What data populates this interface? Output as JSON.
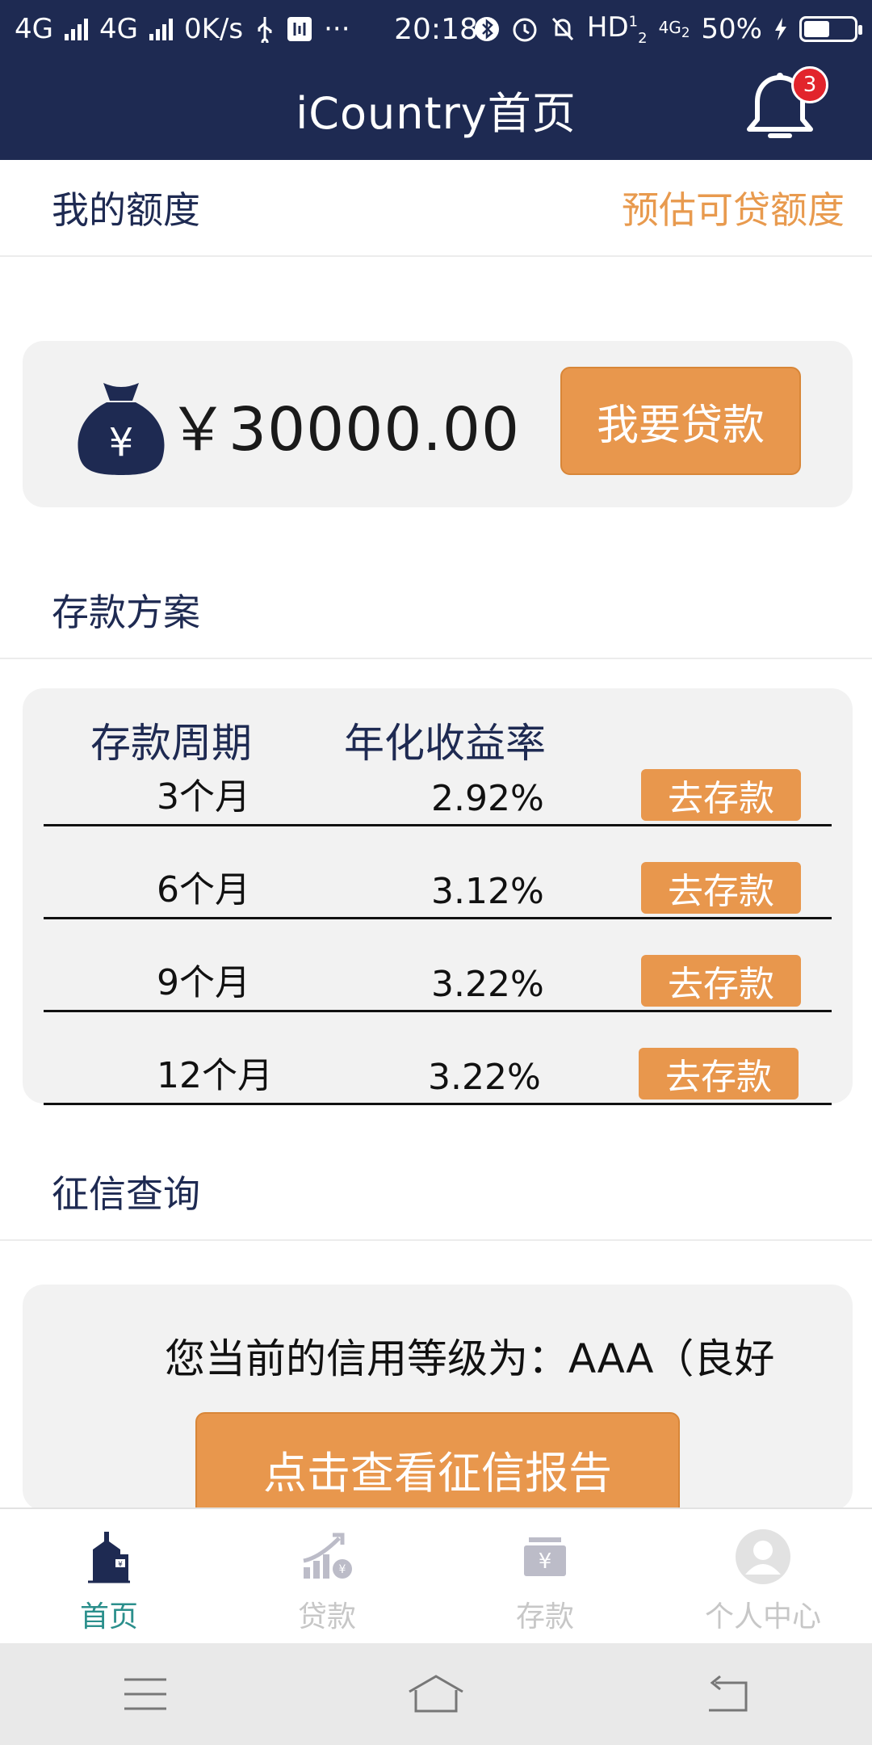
{
  "status_bar": {
    "network1": "4G",
    "network2": "4G",
    "speed": "0K/s",
    "more": "···",
    "time": "20:18",
    "hd": "HD",
    "hd_sup": "1",
    "hd_sub": "2",
    "network3": "4G",
    "network3_sub": "2",
    "battery_text": "50%",
    "battery_level": 0.5
  },
  "header": {
    "title": "iCountry首页",
    "notification_count": "3"
  },
  "quota_section": {
    "title": "我的额度",
    "link": "预估可贷额度",
    "amount": "￥30000.00",
    "loan_button": "我要贷款"
  },
  "deposit_section": {
    "title": "存款方案",
    "headers": [
      "存款周期",
      "年化收益率"
    ],
    "rows": [
      {
        "period": "3个月",
        "rate": "2.92%",
        "button": "去存款"
      },
      {
        "period": "6个月",
        "rate": "3.12%",
        "button": "去存款"
      },
      {
        "period": "9个月",
        "rate": "3.22%",
        "button": "去存款"
      },
      {
        "period": "12个月",
        "rate": "3.22%",
        "button": "去存款"
      }
    ]
  },
  "credit_section": {
    "title": "征信查询",
    "text": "您当前的信用等级为：AAA（良好",
    "report_button": "点击查看征信报告"
  },
  "tabs": [
    {
      "label": "首页",
      "icon": "building-icon",
      "active": true
    },
    {
      "label": "贷款",
      "icon": "growth-chart-icon",
      "active": false
    },
    {
      "label": "存款",
      "icon": "deposit-box-icon",
      "active": false
    },
    {
      "label": "个人中心",
      "icon": "user-avatar-icon",
      "active": false
    }
  ],
  "colors": {
    "header_bg": "#1e2a52",
    "accent": "#e8974d",
    "active_tab": "#2b8f8c"
  }
}
